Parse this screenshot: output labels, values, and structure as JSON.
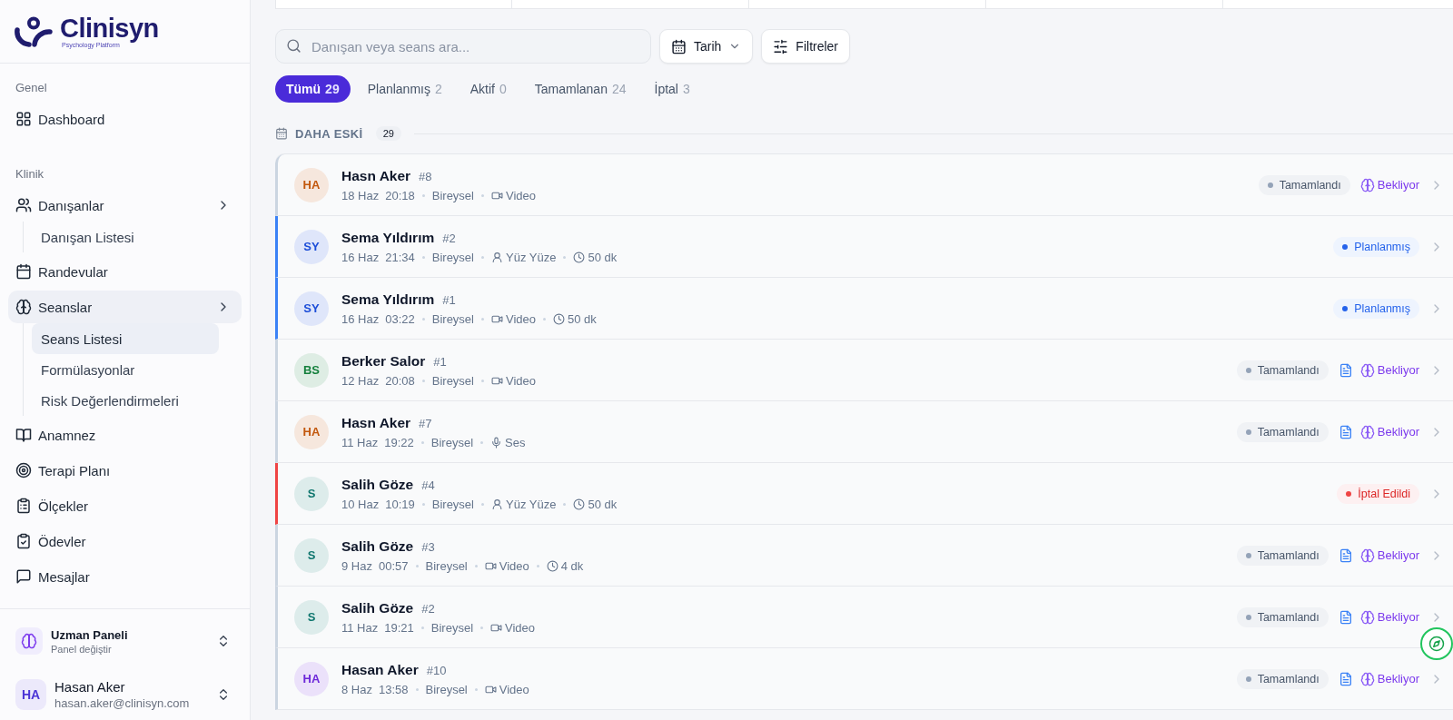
{
  "sidebar": {
    "logo": {
      "name": "Clinisyn",
      "tagline": "Psychology Platform"
    },
    "sections": [
      {
        "title": "Genel",
        "items": [
          {
            "label": "Dashboard",
            "selected": false
          }
        ]
      },
      {
        "title": "Klinik",
        "items": [
          {
            "label": "Danışanlar",
            "selected": false,
            "children": [
              {
                "label": "Danışan Listesi",
                "selected": false
              }
            ]
          },
          {
            "label": "Randevular",
            "selected": false
          },
          {
            "label": "Seanslar",
            "selected": true,
            "children": [
              {
                "label": "Seans Listesi",
                "selected": true
              },
              {
                "label": "Formülasyonlar",
                "selected": false
              },
              {
                "label": "Risk Değerlendirmeleri",
                "selected": false
              }
            ]
          },
          {
            "label": "Anamnez",
            "selected": false
          },
          {
            "label": "Terapi Planı",
            "selected": false
          },
          {
            "label": "Ölçekler",
            "selected": false
          },
          {
            "label": "Ödevler",
            "selected": false
          },
          {
            "label": "Mesajlar",
            "selected": false
          }
        ]
      }
    ],
    "panel_switcher": {
      "title": "Uzman Paneli",
      "subtitle": "Panel değiştir"
    },
    "user": {
      "initials": "HA",
      "name": "Hasan Aker",
      "email": "hasan.aker@clinisyn.com"
    }
  },
  "toolbar": {
    "search": {
      "placeholder": "Danışan veya seans ara..."
    },
    "date_button": {
      "label": "Tarih"
    },
    "filter_button": {
      "label": "Filtreler"
    }
  },
  "tabs": [
    {
      "label": "Tümü",
      "count": "29",
      "selected": true
    },
    {
      "label": "Planlanmış",
      "count": "2",
      "selected": false
    },
    {
      "label": "Aktif",
      "count": "0",
      "selected": false
    },
    {
      "label": "Tamamlanan",
      "count": "24",
      "selected": false
    },
    {
      "label": "İptal",
      "count": "3",
      "selected": false
    }
  ],
  "section": {
    "title": "DAHA ESKİ",
    "count": "29"
  },
  "sessions": [
    {
      "initials": "HA",
      "color": "#c2570c",
      "client": "Hasn Aker",
      "number": "#8",
      "date": "18 Haz",
      "time": "20:18",
      "type": "Bireysel",
      "mode": {
        "kind": "video",
        "label": "Video"
      },
      "status": {
        "kind": "completed",
        "label": "Tamamlandı"
      },
      "note": false,
      "ai": {
        "label": "Bekliyor"
      }
    },
    {
      "initials": "SY",
      "color": "#1d4ed8",
      "client": "Sema Yıldırım",
      "number": "#2",
      "date": "16 Haz",
      "time": "21:34",
      "type": "Bireysel",
      "mode": {
        "kind": "in_person",
        "label": "Yüz Yüze"
      },
      "duration": "50 dk",
      "status": {
        "kind": "scheduled",
        "label": "Planlanmış"
      },
      "note": false
    },
    {
      "initials": "SY",
      "color": "#1d4ed8",
      "client": "Sema Yıldırım",
      "number": "#1",
      "date": "16 Haz",
      "time": "03:22",
      "type": "Bireysel",
      "mode": {
        "kind": "video",
        "label": "Video"
      },
      "duration": "50 dk",
      "status": {
        "kind": "scheduled",
        "label": "Planlanmış"
      },
      "note": false
    },
    {
      "initials": "BS",
      "color": "#15803d",
      "client": "Berker Salor",
      "number": "#1",
      "date": "12 Haz",
      "time": "20:08",
      "type": "Bireysel",
      "mode": {
        "kind": "video",
        "label": "Video"
      },
      "status": {
        "kind": "completed",
        "label": "Tamamlandı"
      },
      "note": true,
      "ai": {
        "label": "Bekliyor"
      }
    },
    {
      "initials": "HA",
      "color": "#c2570c",
      "client": "Hasn Aker",
      "number": "#7",
      "date": "11 Haz",
      "time": "19:22",
      "type": "Bireysel",
      "mode": {
        "kind": "audio",
        "label": "Ses"
      },
      "status": {
        "kind": "completed",
        "label": "Tamamlandı"
      },
      "note": true,
      "ai": {
        "label": "Bekliyor"
      }
    },
    {
      "initials": "S",
      "color": "#0f766e",
      "client": "Salih Göze",
      "number": "#4",
      "date": "10 Haz",
      "time": "10:19",
      "type": "Bireysel",
      "mode": {
        "kind": "in_person",
        "label": "Yüz Yüze"
      },
      "duration": "50 dk",
      "status": {
        "kind": "cancelled",
        "label": "İptal Edildi"
      },
      "note": false
    },
    {
      "initials": "S",
      "color": "#0f766e",
      "client": "Salih Göze",
      "number": "#3",
      "date": "9 Haz",
      "time": "00:57",
      "type": "Bireysel",
      "mode": {
        "kind": "video",
        "label": "Video"
      },
      "duration": "4 dk",
      "status": {
        "kind": "completed",
        "label": "Tamamlandı"
      },
      "note": true,
      "ai": {
        "label": "Bekliyor"
      }
    },
    {
      "initials": "S",
      "color": "#0f766e",
      "client": "Salih Göze",
      "number": "#2",
      "date": "11 Haz",
      "time": "19:21",
      "type": "Bireysel",
      "mode": {
        "kind": "video",
        "label": "Video"
      },
      "status": {
        "kind": "completed",
        "label": "Tamamlandı"
      },
      "note": true,
      "ai": {
        "label": "Bekliyor"
      }
    },
    {
      "initials": "HA",
      "color": "#6d28d9",
      "client": "Hasan Aker",
      "number": "#10",
      "date": "8 Haz",
      "time": "13:58",
      "type": "Bireysel",
      "mode": {
        "kind": "video",
        "label": "Video"
      },
      "status": {
        "kind": "completed",
        "label": "Tamamlandı"
      },
      "note": true,
      "ai": {
        "label": "Bekliyor"
      }
    }
  ]
}
